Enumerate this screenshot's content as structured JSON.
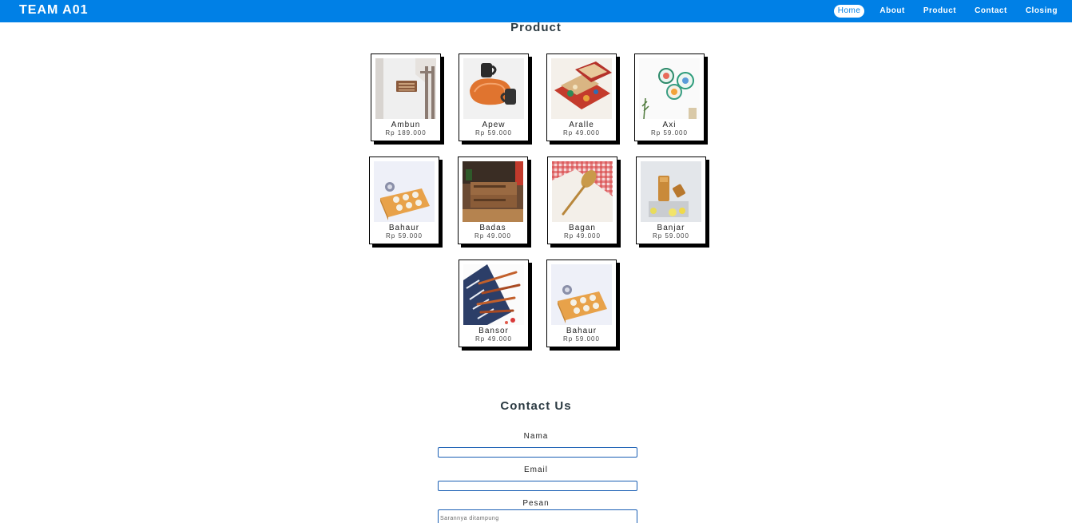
{
  "header": {
    "brand": "TEAM A01",
    "nav": [
      "Home",
      "About",
      "Product",
      "Contact",
      "Closing"
    ]
  },
  "product_section": {
    "title": "Product",
    "items": [
      {
        "name": "Ambun",
        "price": "Rp 189.000"
      },
      {
        "name": "Apew",
        "price": "Rp 59.000"
      },
      {
        "name": "Aralle",
        "price": "Rp 49.000"
      },
      {
        "name": "Axi",
        "price": "Rp 59.000"
      },
      {
        "name": "Bahaur",
        "price": "Rp 59.000"
      },
      {
        "name": "Badas",
        "price": "Rp 49.000"
      },
      {
        "name": "Bagan",
        "price": "Rp 49.000"
      },
      {
        "name": "Banjar",
        "price": "Rp 59.000"
      },
      {
        "name": "Bansor",
        "price": "Rp 49.000"
      },
      {
        "name": "Bahaur",
        "price": "Rp 59.000"
      }
    ]
  },
  "contact_section": {
    "title": "Contact Us",
    "name_label": "Nama",
    "email_label": "Email",
    "message_label": "Pesan",
    "message_placeholder": "Sarannya ditampung"
  },
  "colors": {
    "nav_bg": "#0080e6",
    "input_border": "#1a5fb4"
  }
}
